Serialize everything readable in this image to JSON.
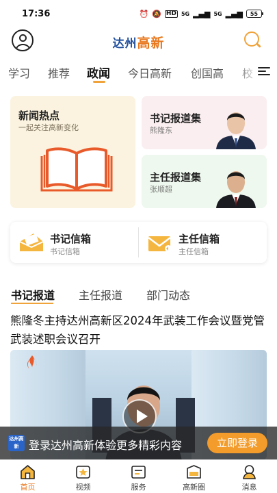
{
  "status_bar": {
    "time": "17:36",
    "signal_1": "5G",
    "signal_2": "5G",
    "battery": "55"
  },
  "header": {
    "logo_part1": "达州",
    "logo_part2": "高新"
  },
  "tabs": [
    {
      "label": "学习"
    },
    {
      "label": "推荐"
    },
    {
      "label": "政闻"
    },
    {
      "label": "今日高新"
    },
    {
      "label": "创国高"
    },
    {
      "label": "校"
    }
  ],
  "active_tab": "政闻",
  "feature_cards": {
    "hot_news": {
      "title": "新闻热点",
      "subtitle": "一起关注高新变化"
    },
    "secretary_reports": {
      "title": "书记报道集",
      "name": "熊隆东"
    },
    "director_reports": {
      "title": "主任报道集",
      "name": "张顺超"
    }
  },
  "mailboxes": [
    {
      "title": "书记信箱",
      "subtitle": "书记信箱"
    },
    {
      "title": "主任信箱",
      "subtitle": "主任信箱"
    }
  ],
  "section_tabs": [
    {
      "label": "书记报道"
    },
    {
      "label": "主任报道"
    },
    {
      "label": "部门动态"
    }
  ],
  "article": {
    "title": "熊隆冬主持达州高新区2024年武装工作会议暨党管武装述职会议召开"
  },
  "login_banner": {
    "logo_text": "达州高新",
    "text": "登录达州高新体验更多精彩内容",
    "button": "立即登录"
  },
  "bottom_nav": [
    {
      "label": "首页",
      "icon": "home-icon"
    },
    {
      "label": "视频",
      "icon": "video-icon"
    },
    {
      "label": "服务",
      "icon": "service-icon"
    },
    {
      "label": "高新圈",
      "icon": "circle-icon"
    },
    {
      "label": "消息",
      "icon": "message-icon"
    }
  ],
  "colors": {
    "accent": "#f0a33a",
    "brand_blue": "#1f4e9c",
    "login_button": "#f39c2c"
  }
}
